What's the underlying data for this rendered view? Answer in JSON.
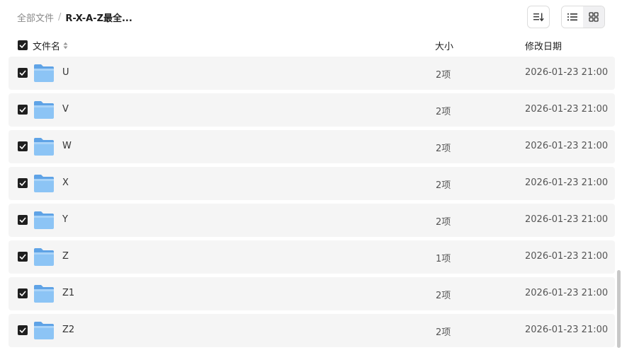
{
  "breadcrumb": {
    "root": "全部文件",
    "separator": "/",
    "current": "R-X-A-Z最全..."
  },
  "columns": {
    "name": "文件名",
    "size": "大小",
    "modified": "修改日期"
  },
  "rows": [
    {
      "name": "U",
      "size": "2项",
      "modified": "2026-01-23 21:00"
    },
    {
      "name": "V",
      "size": "2项",
      "modified": "2026-01-23 21:00"
    },
    {
      "name": "W",
      "size": "2项",
      "modified": "2026-01-23 21:00"
    },
    {
      "name": "X",
      "size": "2项",
      "modified": "2026-01-23 21:00"
    },
    {
      "name": "Y",
      "size": "2项",
      "modified": "2026-01-23 21:00"
    },
    {
      "name": "Z",
      "size": "1项",
      "modified": "2026-01-23 21:00"
    },
    {
      "name": "Z1",
      "size": "2项",
      "modified": "2026-01-23 21:00"
    },
    {
      "name": "Z2",
      "size": "2项",
      "modified": "2026-01-23 21:00"
    }
  ],
  "icons": {
    "sort": "sort-icon",
    "list_view": "list-view-icon",
    "grid_view": "grid-view-icon",
    "folder": "folder-icon",
    "check": "check-icon"
  },
  "colors": {
    "row_bg": "#f5f5f5",
    "checkbox": "#1f1f1f",
    "folder": "#7db9f0"
  }
}
